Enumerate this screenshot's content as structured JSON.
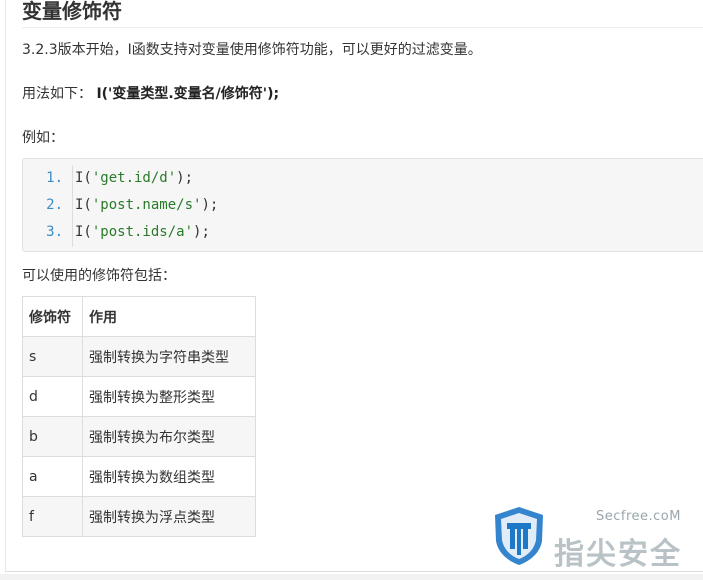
{
  "section": {
    "title": "变量修饰符",
    "intro": "3.2.3版本开始，I函数支持对变量使用修饰符功能，可以更好的过滤变量。",
    "usage_label": "用法如下：",
    "usage_code": "I('变量类型.变量名/修饰符');",
    "example_label": "例如：",
    "modifiers_label": "可以使用的修饰符包括："
  },
  "code_block": {
    "lines": [
      {
        "num": "1.",
        "fn": "I(",
        "str": "'get.id/d'",
        "tail": ");"
      },
      {
        "num": "2.",
        "fn": "I(",
        "str": "'post.name/s'",
        "tail": ");"
      },
      {
        "num": "3.",
        "fn": "I(",
        "str": "'post.ids/a'",
        "tail": ");"
      }
    ]
  },
  "table": {
    "headers": [
      "修饰符",
      "作用"
    ],
    "rows": [
      [
        "s",
        "强制转换为字符串类型"
      ],
      [
        "d",
        "强制转换为整形类型"
      ],
      [
        "b",
        "强制转换为布尔类型"
      ],
      [
        "a",
        "强制转换为数组类型"
      ],
      [
        "f",
        "强制转换为浮点类型"
      ]
    ]
  },
  "watermark": {
    "site": "Secfree.coM",
    "name": "指尖安全",
    "color": "#1e78c8"
  }
}
